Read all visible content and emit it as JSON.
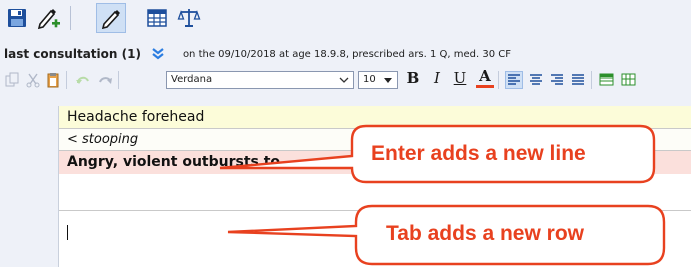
{
  "toolbar": {
    "buttons": [
      {
        "name": "save-icon"
      },
      {
        "name": "edit-add-icon"
      },
      {
        "name": "pencil-icon"
      },
      {
        "name": "grid-table-icon"
      },
      {
        "name": "scales-icon"
      }
    ]
  },
  "consultation": {
    "title": "last consultation (1)",
    "info": "on the 09/10/2018 at age 18.9.8, prescribed ars. 1 Q, med. 30 CF"
  },
  "format_toolbar": {
    "font": "Verdana",
    "size": "10",
    "bold": "B",
    "italic": "I",
    "underline": "U",
    "font_color_letter": "A"
  },
  "editor": {
    "rows": [
      {
        "text": "Headache forehead"
      },
      {
        "text": "< stooping"
      },
      {
        "text": "Angry, violent outbursts to"
      },
      {
        "text": ""
      }
    ]
  },
  "callouts": {
    "enter": "Enter adds a new line",
    "tab": "Tab adds a new row"
  },
  "colors": {
    "accent": "#e8411f",
    "row_yellow": "#fcfcd9",
    "row_pink": "#fbe0dc",
    "toolbar_bg": "#eef1f8"
  }
}
